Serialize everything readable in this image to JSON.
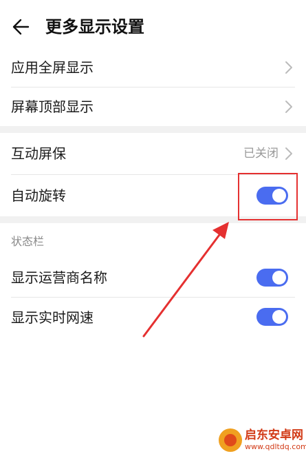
{
  "header": {
    "title": "更多显示设置",
    "back_icon": "back-arrow-icon"
  },
  "section1": {
    "items": [
      {
        "label": "应用全屏显示",
        "icon": "chevron-right-icon"
      },
      {
        "label": "屏幕顶部显示",
        "icon": "chevron-right-icon"
      }
    ]
  },
  "section2": {
    "items": [
      {
        "label": "互动屏保",
        "value": "已关闭",
        "icon": "chevron-right-icon"
      },
      {
        "label": "自动旋转",
        "toggle_on": true
      }
    ]
  },
  "status_bar_section": {
    "header": "状态栏",
    "items": [
      {
        "label": "显示运营商名称",
        "toggle_on": true
      },
      {
        "label": "显示实时网速",
        "toggle_on": true
      }
    ]
  },
  "annotation": {
    "color": "#e53030"
  },
  "watermark": {
    "title": "启东安卓网",
    "url": "www.qdltdq.com"
  },
  "colors": {
    "toggle_on": "#4a6cf0",
    "gap": "#f1f1f1",
    "annotation": "#e53030"
  }
}
